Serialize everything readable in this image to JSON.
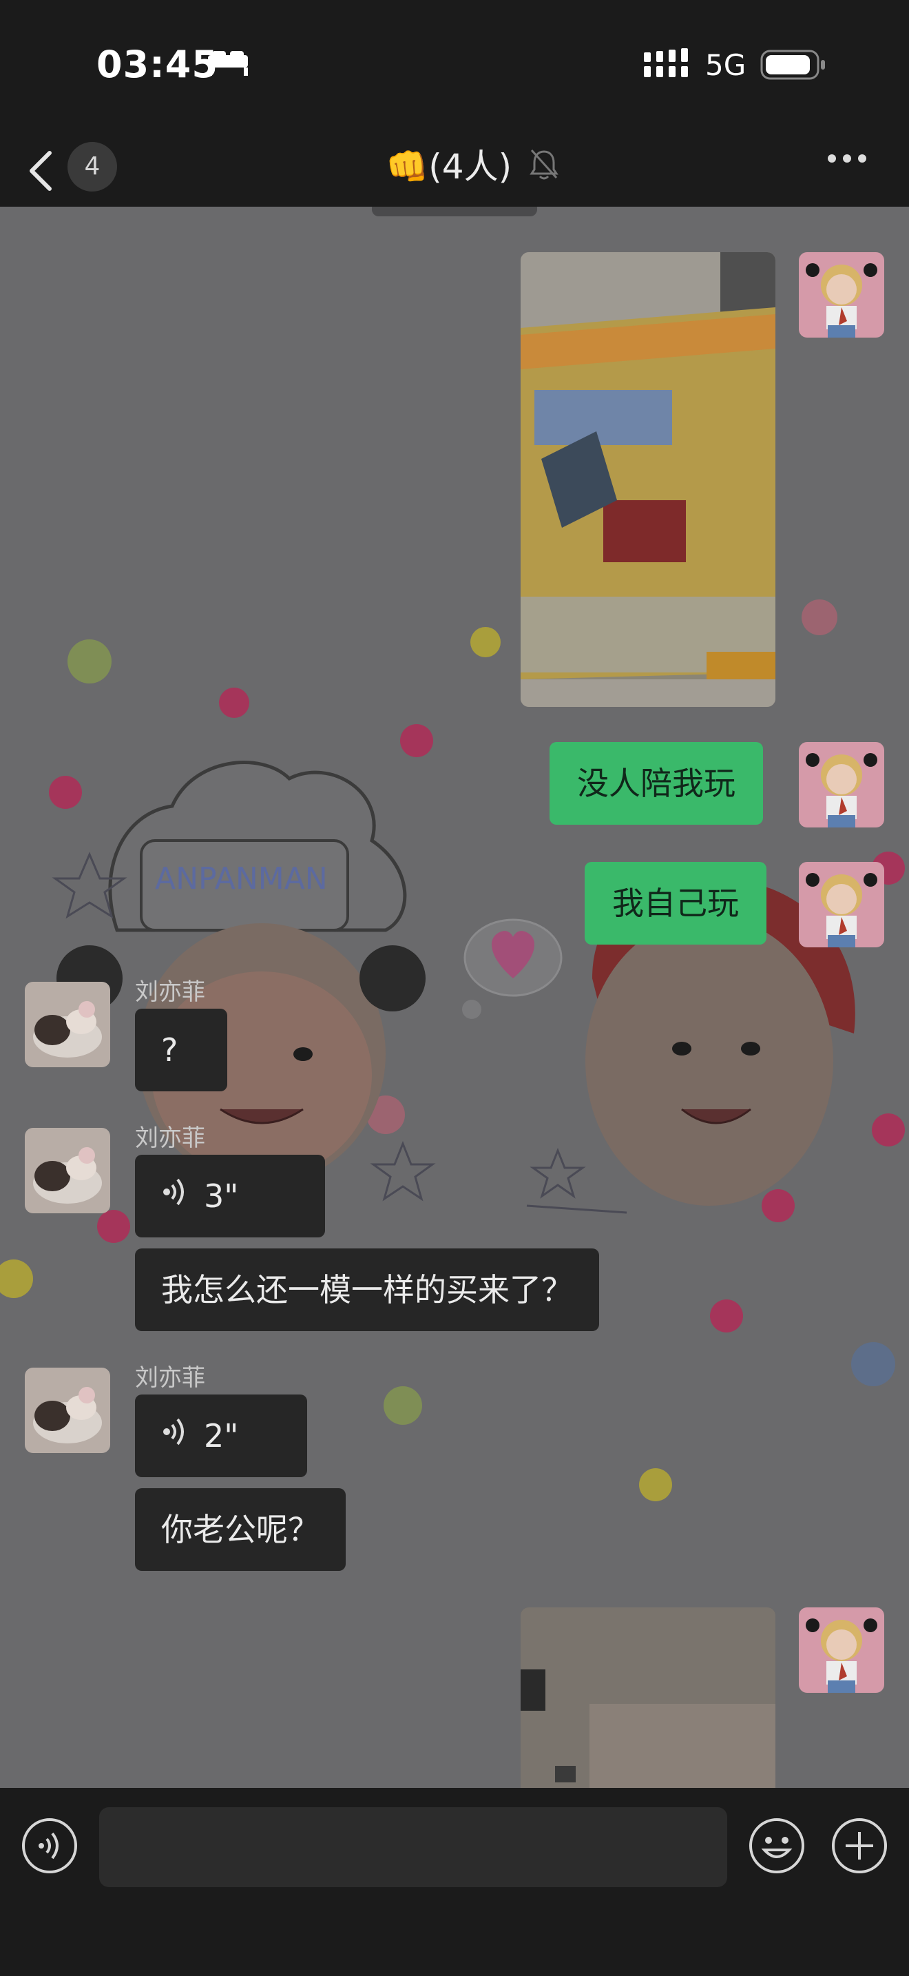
{
  "status": {
    "time": "03:45",
    "network": "5G"
  },
  "nav": {
    "unread_count": "4",
    "title": "👊(4人)"
  },
  "messages": [
    {
      "type": "image",
      "direction": "sent",
      "alt": "board-game-photo"
    },
    {
      "type": "text",
      "direction": "sent",
      "text": "没人陪我玩"
    },
    {
      "type": "text",
      "direction": "sent",
      "text": "我自己玩"
    },
    {
      "type": "text",
      "direction": "received",
      "sender": "刘亦菲",
      "text": "?"
    },
    {
      "type": "voice",
      "direction": "received",
      "sender": "刘亦菲",
      "duration": "3\""
    },
    {
      "type": "text",
      "direction": "received",
      "text": "我怎么还一模一样的买来了？"
    },
    {
      "type": "voice",
      "direction": "received",
      "sender": "刘亦菲",
      "duration": "2\""
    },
    {
      "type": "text",
      "direction": "received",
      "text": "你老公呢？"
    },
    {
      "type": "image",
      "direction": "sent",
      "alt": "room-photo"
    }
  ],
  "wallpaper": {
    "decor_text": "ANPANMAN"
  },
  "colors": {
    "sent_bubble": "#3ab96a",
    "received_bubble": "#262626",
    "chat_bg": "#6a6a6c"
  },
  "icons": [
    "sleep-icon",
    "signal-icon",
    "battery-icon",
    "back-icon",
    "mute-icon",
    "more-icon",
    "voice-icon",
    "emoji-icon",
    "plus-icon"
  ]
}
